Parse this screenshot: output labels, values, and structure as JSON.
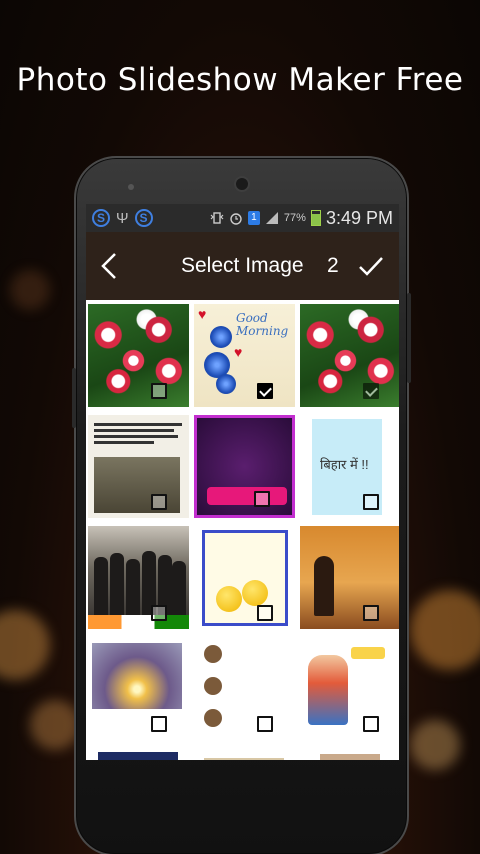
{
  "promo": {
    "title": "Photo Slideshow Maker Free"
  },
  "statusbar": {
    "left_icons": [
      "s-app-icon",
      "usb-icon",
      "s-app-icon"
    ],
    "notification_badge": "1",
    "battery_percent": "77%",
    "time": "3:49 PM"
  },
  "appbar": {
    "title": "Select Image",
    "selected_count": "2"
  },
  "grid": {
    "images": [
      {
        "name": "red-flowers-image",
        "checked": false
      },
      {
        "name": "good-morning-roses-image",
        "checked": true
      },
      {
        "name": "red-flowers-image-copy",
        "checked": true
      },
      {
        "name": "hindi-news-crowd-image",
        "checked": false
      },
      {
        "name": "pink-flower-quote-image",
        "checked": false
      },
      {
        "name": "bihar-quote-image",
        "checked": false
      },
      {
        "name": "group-photo-image",
        "checked": false
      },
      {
        "name": "emoji-quote-image",
        "checked": false
      },
      {
        "name": "buddha-statue-image",
        "checked": false
      },
      {
        "name": "candle-girl-image",
        "checked": false
      },
      {
        "name": "meme-text-image",
        "checked": false
      },
      {
        "name": "jokes-cartoon-image",
        "checked": false
      },
      {
        "name": "quote-card-image",
        "checked": false
      },
      {
        "name": "text-post-image",
        "checked": false
      },
      {
        "name": "beige-card-image",
        "checked": false
      }
    ]
  },
  "image_text": {
    "good_morning": "Good Morning",
    "bihar": "बिहार में !!"
  },
  "colors": {
    "appbar_bg": "#2e221a",
    "statusbar_bg": "#2b2b2b",
    "accent_blue": "#3f7fe0"
  }
}
